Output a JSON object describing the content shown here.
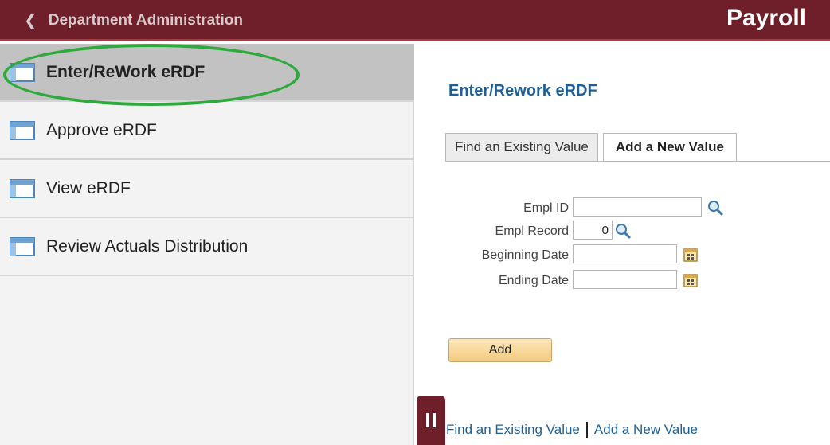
{
  "header": {
    "back_label": "Department Administration",
    "app_title": "Payroll",
    "bar_color": "#6e1f2a"
  },
  "sidebar": {
    "items": [
      {
        "label": "Enter/ReWork eRDF",
        "icon": "page-icon",
        "active": true
      },
      {
        "label": "Approve eRDF",
        "icon": "page-icon",
        "active": false
      },
      {
        "label": "View eRDF",
        "icon": "page-icon",
        "active": false
      },
      {
        "label": "Review Actuals Distribution",
        "icon": "page-icon",
        "active": false
      }
    ],
    "highlight_color": "#2eaa3c"
  },
  "main": {
    "title": "Enter/Rework eRDF",
    "tabs": [
      {
        "label": "Find an Existing Value",
        "active": false
      },
      {
        "label": "Add a New Value",
        "active": true
      }
    ],
    "fields": {
      "empl_id": {
        "label": "Empl ID",
        "value": ""
      },
      "empl_record": {
        "label": "Empl Record",
        "value": "0"
      },
      "beginning_date": {
        "label": "Beginning Date",
        "value": ""
      },
      "ending_date": {
        "label": "Ending Date",
        "value": ""
      }
    },
    "add_button": "Add"
  },
  "footer": {
    "find_link": "Find an Existing Value",
    "add_link": "Add a New Value"
  },
  "icons": {
    "lookup": "magnifier-icon",
    "calendar": "calendar-icon",
    "collapse": "pause-icon",
    "back": "chevron-left-icon"
  }
}
